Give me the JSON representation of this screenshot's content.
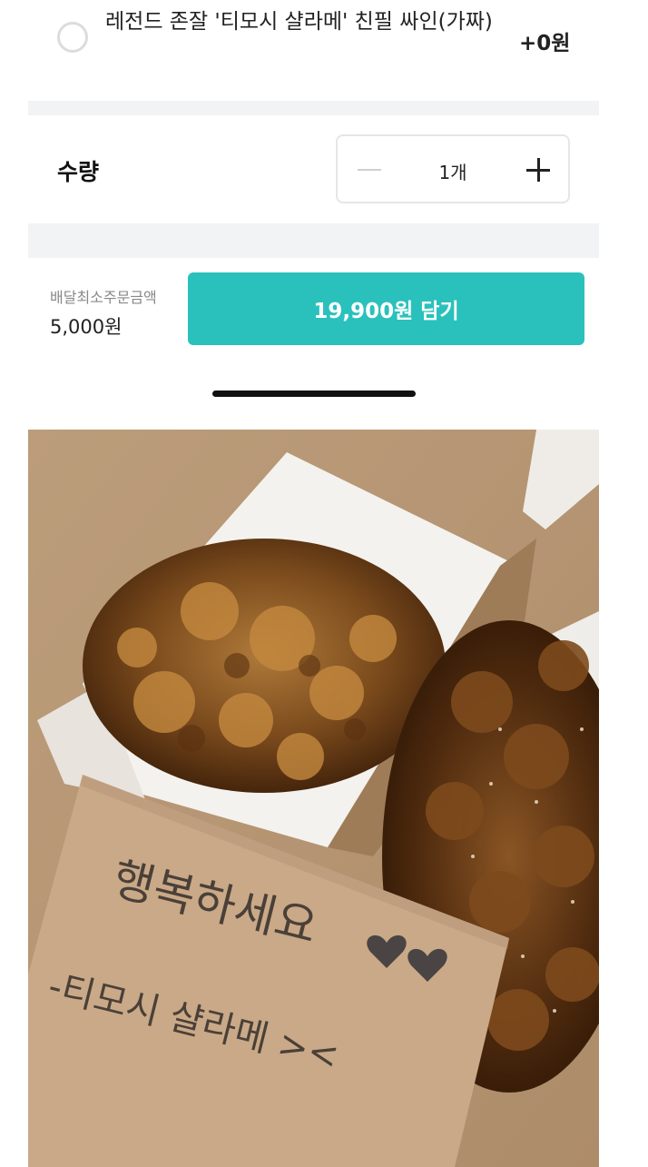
{
  "option": {
    "label": "레전드 존잘 '티모시 샬라메' 친필 싸인(가짜)",
    "price": "+0원"
  },
  "quantity": {
    "label": "수량",
    "value": "1개"
  },
  "order": {
    "min_label": "배달최소주문금액",
    "min_value": "5,000원",
    "cart_button": "19,900원 담기"
  },
  "photo": {
    "note_line1": "행복하세요",
    "note_line2": "-티모시 샬라메 ><"
  },
  "colors": {
    "accent": "#2ac1bc",
    "divider": "#f1f3f5"
  }
}
